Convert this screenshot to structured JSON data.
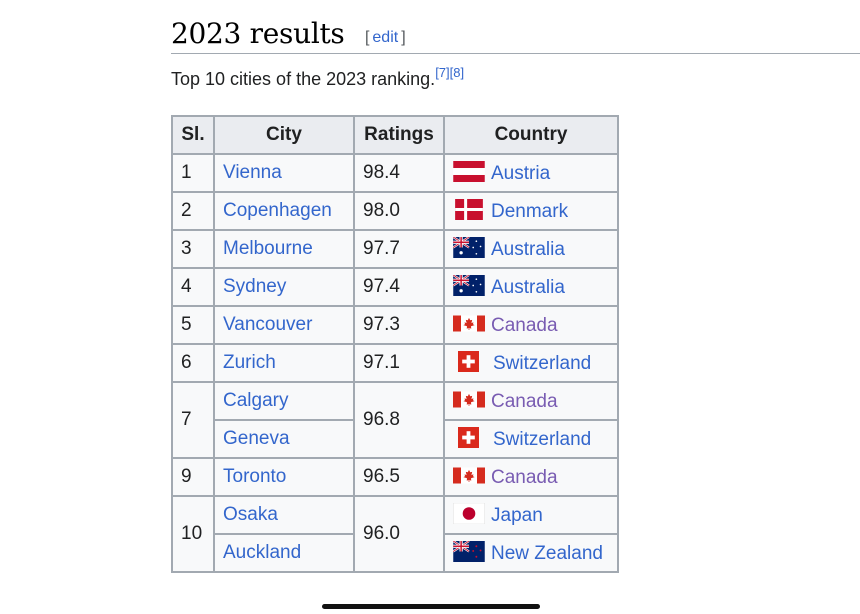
{
  "section": {
    "title": "2023 results",
    "edit_open": "[",
    "edit_label": "edit",
    "edit_close": "]"
  },
  "intro": {
    "text": "Top 10 cities of the 2023 ranking.",
    "refs": [
      "[7]",
      "[8]"
    ]
  },
  "table": {
    "headers": [
      "Sl.",
      "City",
      "Ratings",
      "Country"
    ],
    "rows": [
      {
        "sl": "1",
        "city": "Vienna",
        "rating": "98.4",
        "country": "Austria",
        "flag": "austria"
      },
      {
        "sl": "2",
        "city": "Copenhagen",
        "rating": "98.0",
        "country": "Denmark",
        "flag": "denmark"
      },
      {
        "sl": "3",
        "city": "Melbourne",
        "rating": "97.7",
        "country": "Australia",
        "flag": "australia"
      },
      {
        "sl": "4",
        "city": "Sydney",
        "rating": "97.4",
        "country": "Australia",
        "flag": "australia"
      },
      {
        "sl": "5",
        "city": "Vancouver",
        "rating": "97.3",
        "country": "Canada",
        "flag": "canada",
        "visited": true
      },
      {
        "sl": "6",
        "city": "Zurich",
        "rating": "97.1",
        "country": "Switzerland",
        "flag": "switzerland"
      },
      {
        "sl": "7",
        "city": "Calgary",
        "rating": "96.8",
        "country": "Canada",
        "flag": "canada",
        "visited": true
      },
      {
        "sl": "",
        "city": "Geneva",
        "rating": "",
        "country": "Switzerland",
        "flag": "switzerland"
      },
      {
        "sl": "9",
        "city": "Toronto",
        "rating": "96.5",
        "country": "Canada",
        "flag": "canada",
        "visited": true
      },
      {
        "sl": "10",
        "city": "Osaka",
        "rating": "96.0",
        "country": "Japan",
        "flag": "japan"
      },
      {
        "sl": "",
        "city": "Auckland",
        "rating": "",
        "country": "New Zealand",
        "flag": "new-zealand"
      }
    ]
  },
  "colors": {
    "link": "#3366cc",
    "visited_link": "#795cb2",
    "border": "#a2a9b1",
    "header_bg": "#eaecf0",
    "cell_bg": "#f8f9fa"
  }
}
